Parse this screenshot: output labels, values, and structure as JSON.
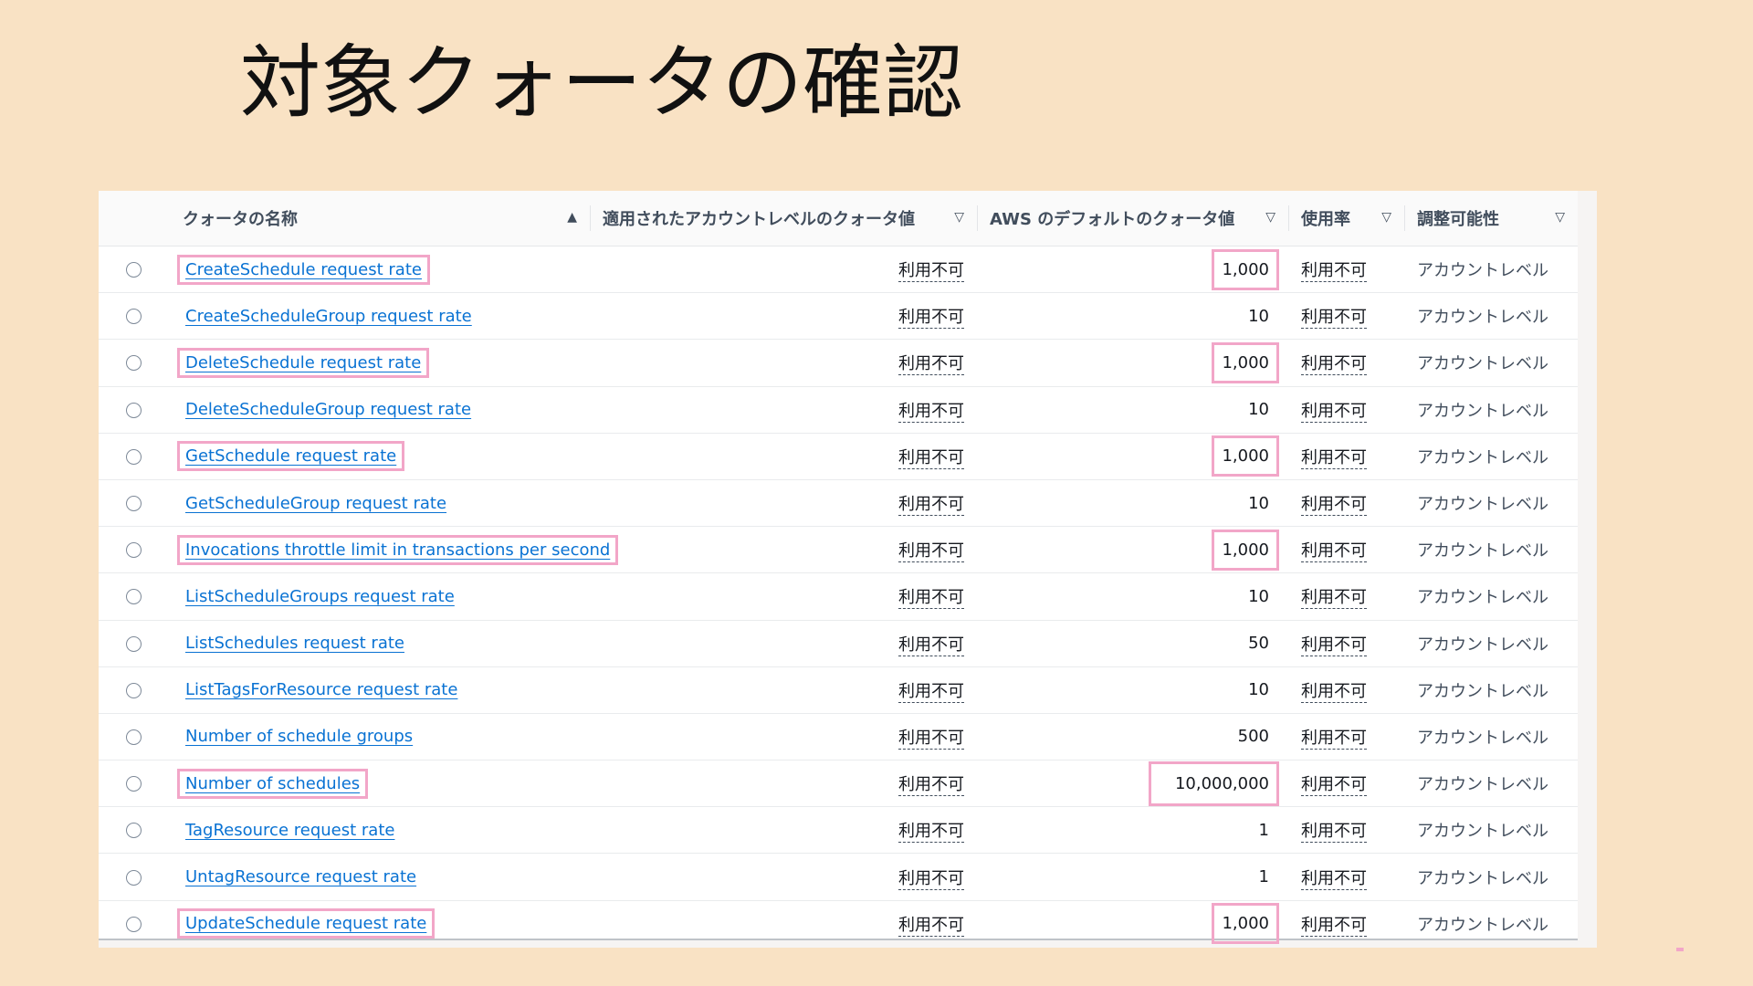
{
  "slide": {
    "title": "対象クォータの確認"
  },
  "table": {
    "headers": {
      "name": "クォータの名称",
      "account_value": "適用されたアカウントレベルのクォータ値",
      "default_value": "AWS のデフォルトのクォータ値",
      "utilization": "使用率",
      "adjustability": "調整可能性"
    },
    "rows": [
      {
        "name": "CreateSchedule request rate",
        "account": "利用不可",
        "default": "1,000",
        "usage": "利用不可",
        "adjust": "アカウントレベル",
        "highlighted": true
      },
      {
        "name": "CreateScheduleGroup request rate",
        "account": "利用不可",
        "default": "10",
        "usage": "利用不可",
        "adjust": "アカウントレベル",
        "highlighted": false
      },
      {
        "name": "DeleteSchedule request rate",
        "account": "利用不可",
        "default": "1,000",
        "usage": "利用不可",
        "adjust": "アカウントレベル",
        "highlighted": true
      },
      {
        "name": "DeleteScheduleGroup request rate",
        "account": "利用不可",
        "default": "10",
        "usage": "利用不可",
        "adjust": "アカウントレベル",
        "highlighted": false
      },
      {
        "name": "GetSchedule request rate",
        "account": "利用不可",
        "default": "1,000",
        "usage": "利用不可",
        "adjust": "アカウントレベル",
        "highlighted": true
      },
      {
        "name": "GetScheduleGroup request rate",
        "account": "利用不可",
        "default": "10",
        "usage": "利用不可",
        "adjust": "アカウントレベル",
        "highlighted": false
      },
      {
        "name": "Invocations throttle limit in transactions per second",
        "account": "利用不可",
        "default": "1,000",
        "usage": "利用不可",
        "adjust": "アカウントレベル",
        "highlighted": true
      },
      {
        "name": "ListScheduleGroups request rate",
        "account": "利用不可",
        "default": "10",
        "usage": "利用不可",
        "adjust": "アカウントレベル",
        "highlighted": false
      },
      {
        "name": "ListSchedules request rate",
        "account": "利用不可",
        "default": "50",
        "usage": "利用不可",
        "adjust": "アカウントレベル",
        "highlighted": false
      },
      {
        "name": "ListTagsForResource request rate",
        "account": "利用不可",
        "default": "10",
        "usage": "利用不可",
        "adjust": "アカウントレベル",
        "highlighted": false
      },
      {
        "name": "Number of schedule groups",
        "account": "利用不可",
        "default": "500",
        "usage": "利用不可",
        "adjust": "アカウントレベル",
        "highlighted": false
      },
      {
        "name": "Number of schedules",
        "account": "利用不可",
        "default": "10,000,000",
        "usage": "利用不可",
        "adjust": "アカウントレベル",
        "highlighted": true
      },
      {
        "name": "TagResource request rate",
        "account": "利用不可",
        "default": "1",
        "usage": "利用不可",
        "adjust": "アカウントレベル",
        "highlighted": false
      },
      {
        "name": "UntagResource request rate",
        "account": "利用不可",
        "default": "1",
        "usage": "利用不可",
        "adjust": "アカウントレベル",
        "highlighted": false
      },
      {
        "name": "UpdateSchedule request rate",
        "account": "利用不可",
        "default": "1,000",
        "usage": "利用不可",
        "adjust": "アカウントレベル",
        "highlighted": true
      }
    ]
  },
  "colors": {
    "background": "#f9e2c4",
    "link": "#0972d3",
    "highlight": "#f2a6c8"
  }
}
